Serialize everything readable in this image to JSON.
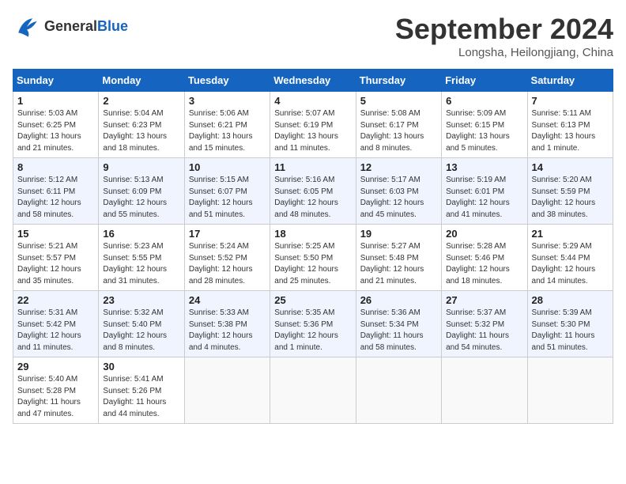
{
  "header": {
    "logo_general": "General",
    "logo_blue": "Blue",
    "month_year": "September 2024",
    "location": "Longsha, Heilongjiang, China"
  },
  "days_of_week": [
    "Sunday",
    "Monday",
    "Tuesday",
    "Wednesday",
    "Thursday",
    "Friday",
    "Saturday"
  ],
  "weeks": [
    [
      {
        "day": "1",
        "info": "Sunrise: 5:03 AM\nSunset: 6:25 PM\nDaylight: 13 hours\nand 21 minutes."
      },
      {
        "day": "2",
        "info": "Sunrise: 5:04 AM\nSunset: 6:23 PM\nDaylight: 13 hours\nand 18 minutes."
      },
      {
        "day": "3",
        "info": "Sunrise: 5:06 AM\nSunset: 6:21 PM\nDaylight: 13 hours\nand 15 minutes."
      },
      {
        "day": "4",
        "info": "Sunrise: 5:07 AM\nSunset: 6:19 PM\nDaylight: 13 hours\nand 11 minutes."
      },
      {
        "day": "5",
        "info": "Sunrise: 5:08 AM\nSunset: 6:17 PM\nDaylight: 13 hours\nand 8 minutes."
      },
      {
        "day": "6",
        "info": "Sunrise: 5:09 AM\nSunset: 6:15 PM\nDaylight: 13 hours\nand 5 minutes."
      },
      {
        "day": "7",
        "info": "Sunrise: 5:11 AM\nSunset: 6:13 PM\nDaylight: 13 hours\nand 1 minute."
      }
    ],
    [
      {
        "day": "8",
        "info": "Sunrise: 5:12 AM\nSunset: 6:11 PM\nDaylight: 12 hours\nand 58 minutes."
      },
      {
        "day": "9",
        "info": "Sunrise: 5:13 AM\nSunset: 6:09 PM\nDaylight: 12 hours\nand 55 minutes."
      },
      {
        "day": "10",
        "info": "Sunrise: 5:15 AM\nSunset: 6:07 PM\nDaylight: 12 hours\nand 51 minutes."
      },
      {
        "day": "11",
        "info": "Sunrise: 5:16 AM\nSunset: 6:05 PM\nDaylight: 12 hours\nand 48 minutes."
      },
      {
        "day": "12",
        "info": "Sunrise: 5:17 AM\nSunset: 6:03 PM\nDaylight: 12 hours\nand 45 minutes."
      },
      {
        "day": "13",
        "info": "Sunrise: 5:19 AM\nSunset: 6:01 PM\nDaylight: 12 hours\nand 41 minutes."
      },
      {
        "day": "14",
        "info": "Sunrise: 5:20 AM\nSunset: 5:59 PM\nDaylight: 12 hours\nand 38 minutes."
      }
    ],
    [
      {
        "day": "15",
        "info": "Sunrise: 5:21 AM\nSunset: 5:57 PM\nDaylight: 12 hours\nand 35 minutes."
      },
      {
        "day": "16",
        "info": "Sunrise: 5:23 AM\nSunset: 5:55 PM\nDaylight: 12 hours\nand 31 minutes."
      },
      {
        "day": "17",
        "info": "Sunrise: 5:24 AM\nSunset: 5:52 PM\nDaylight: 12 hours\nand 28 minutes."
      },
      {
        "day": "18",
        "info": "Sunrise: 5:25 AM\nSunset: 5:50 PM\nDaylight: 12 hours\nand 25 minutes."
      },
      {
        "day": "19",
        "info": "Sunrise: 5:27 AM\nSunset: 5:48 PM\nDaylight: 12 hours\nand 21 minutes."
      },
      {
        "day": "20",
        "info": "Sunrise: 5:28 AM\nSunset: 5:46 PM\nDaylight: 12 hours\nand 18 minutes."
      },
      {
        "day": "21",
        "info": "Sunrise: 5:29 AM\nSunset: 5:44 PM\nDaylight: 12 hours\nand 14 minutes."
      }
    ],
    [
      {
        "day": "22",
        "info": "Sunrise: 5:31 AM\nSunset: 5:42 PM\nDaylight: 12 hours\nand 11 minutes."
      },
      {
        "day": "23",
        "info": "Sunrise: 5:32 AM\nSunset: 5:40 PM\nDaylight: 12 hours\nand 8 minutes."
      },
      {
        "day": "24",
        "info": "Sunrise: 5:33 AM\nSunset: 5:38 PM\nDaylight: 12 hours\nand 4 minutes."
      },
      {
        "day": "25",
        "info": "Sunrise: 5:35 AM\nSunset: 5:36 PM\nDaylight: 12 hours\nand 1 minute."
      },
      {
        "day": "26",
        "info": "Sunrise: 5:36 AM\nSunset: 5:34 PM\nDaylight: 11 hours\nand 58 minutes."
      },
      {
        "day": "27",
        "info": "Sunrise: 5:37 AM\nSunset: 5:32 PM\nDaylight: 11 hours\nand 54 minutes."
      },
      {
        "day": "28",
        "info": "Sunrise: 5:39 AM\nSunset: 5:30 PM\nDaylight: 11 hours\nand 51 minutes."
      }
    ],
    [
      {
        "day": "29",
        "info": "Sunrise: 5:40 AM\nSunset: 5:28 PM\nDaylight: 11 hours\nand 47 minutes."
      },
      {
        "day": "30",
        "info": "Sunrise: 5:41 AM\nSunset: 5:26 PM\nDaylight: 11 hours\nand 44 minutes."
      },
      {
        "day": "",
        "info": ""
      },
      {
        "day": "",
        "info": ""
      },
      {
        "day": "",
        "info": ""
      },
      {
        "day": "",
        "info": ""
      },
      {
        "day": "",
        "info": ""
      }
    ]
  ]
}
